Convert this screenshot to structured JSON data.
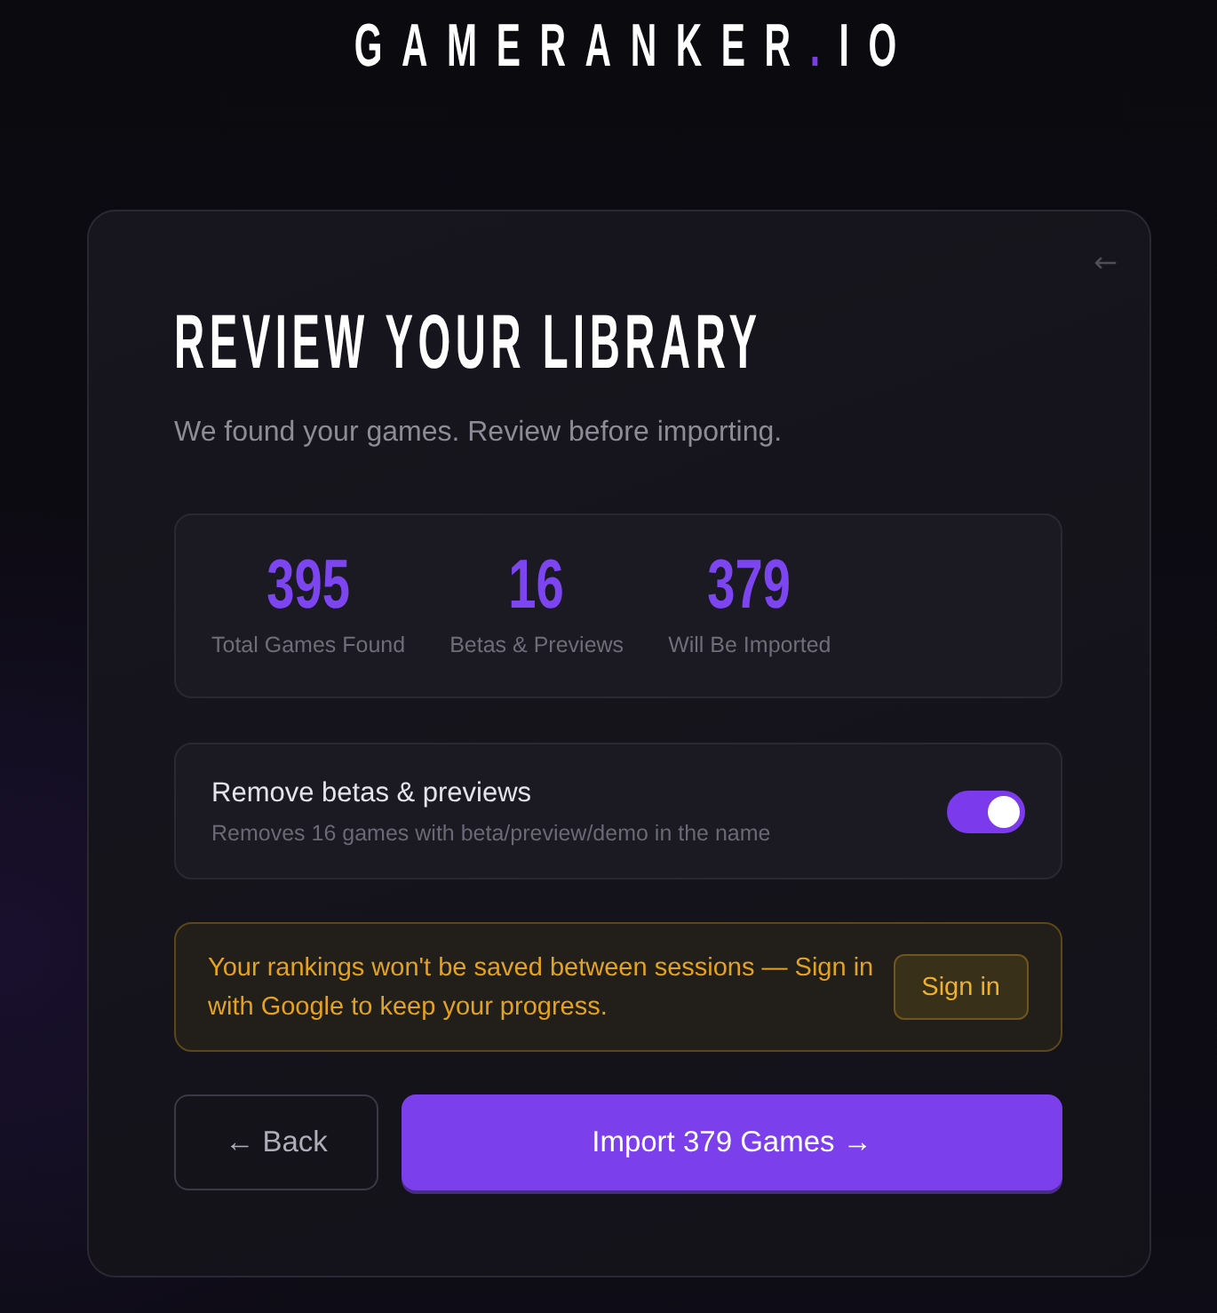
{
  "logo": {
    "name": "GAMERANKER",
    "dot": ".",
    "suffix": "IO"
  },
  "card": {
    "corner_button": "←",
    "title": "REVIEW YOUR LIBRARY",
    "subtitle": "We found your games. Review before importing."
  },
  "stats": [
    {
      "value": "395",
      "label": "Total Games Found"
    },
    {
      "value": "16",
      "label": "Betas & Previews"
    },
    {
      "value": "379",
      "label": "Will Be Imported"
    }
  ],
  "filter_option": {
    "label": "Remove betas & previews",
    "description": "Removes 16 games with beta/preview/demo in the name",
    "on": true
  },
  "notice": {
    "message": "Your rankings won't be saved between sessions — Sign in with Google to keep your progress.",
    "button": "Sign in"
  },
  "actions": [
    {
      "kind": "secondary",
      "label": "← Back"
    },
    {
      "kind": "primary",
      "label": "Import 379 Games →"
    }
  ]
}
